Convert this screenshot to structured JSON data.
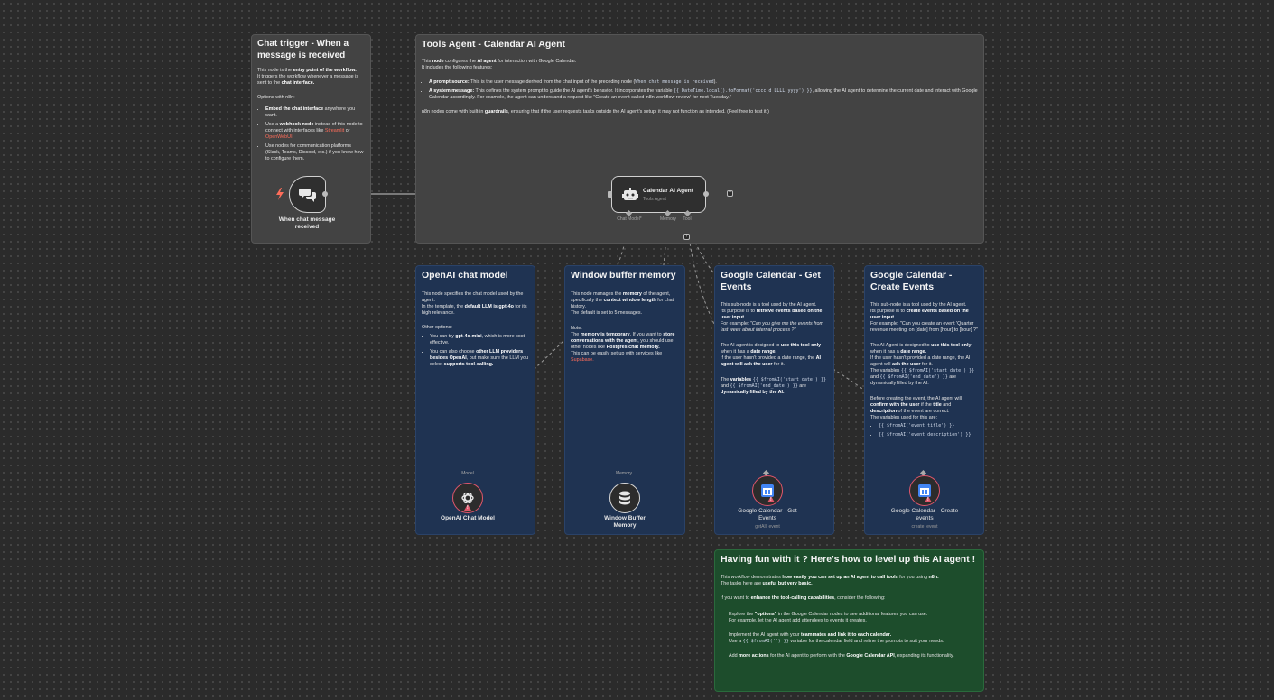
{
  "chat_trigger_note": {
    "title": "Chat trigger - When a message is received",
    "line1_pre": "This node is the ",
    "line1_bold": "entry point of the workflow.",
    "line2_pre": "It triggers the workflow whenever a message is sent to the ",
    "line2_bold": "chat interface.",
    "options_heading": "Options with n8n:",
    "opt1_bold": "Embed the chat interface",
    "opt1_rest": " anywhere you want.",
    "opt2_pre": "Use a ",
    "opt2_bold": "webhook node",
    "opt2_rest": " instead of this node to connect with interfaces like ",
    "opt2_link1": "Streamlit",
    "opt2_or": " or ",
    "opt2_link2": "OpenWebUI.",
    "opt3": "Use nodes for communication platforms (Slack, Teams, Discord, etc.) if you know how to configure them."
  },
  "tools_agent_note": {
    "title": "Tools Agent - Calendar AI Agent",
    "intro_pre": "This ",
    "intro_bold1": "node",
    "intro_mid": " configures the ",
    "intro_bold2": "AI agent",
    "intro_rest": " for interaction with Google Calendar.",
    "intro2": "It includes the following features:",
    "f1_bold": "A prompt source:",
    "f1_rest": " This is the user message derived from the chat input of the preceding node (",
    "f1_code": "When chat message is received",
    "f1_end": ").",
    "f2_bold": "A system message:",
    "f2_rest": " This defines the system prompt to guide the AI agent's behavior. It incorporates the variable ",
    "f2_code": "{{ DateTime.local().toFormat('cccc d LLLL yyyy') }}",
    "f2_end": ", allowing the AI agent to determine the current date and interact with Google Calendar accordingly. For example, the agent can understand a request like \"Create an event called 'n8n workflow review' for next Tuesday.\"",
    "guard_pre": "n8n nodes come with built-in ",
    "guard_bold": "guardrails",
    "guard_rest": ", ensuring that if the user requests tasks outside the AI agent's setup, it may not function as intended. (Feel free to test it!)"
  },
  "openai_note": {
    "title": "OpenAI chat model",
    "p1": "This node specifies the chat model used by the agent.",
    "p2_pre": "In the template, the ",
    "p2_bold": "default LLM is gpt-4o",
    "p2_rest": " for its high relevance.",
    "other": "Other options:",
    "o1_pre": "You can try ",
    "o1_bold": "gpt-4o-mini",
    "o1_rest": ", which is more cost-effective.",
    "o2_pre": "You can also choose ",
    "o2_bold": "other LLM providers besides OpenAI",
    "o2_rest": ", but make sure the LLM you select ",
    "o2_bold2": "supports tool-calling."
  },
  "memory_note": {
    "title": "Window buffer memory",
    "p1_pre": "This node manages the ",
    "p1_bold": "memory",
    "p1_mid": " of the agent, specifically the ",
    "p1_bold2": "context window length",
    "p1_rest": " for chat history.",
    "p2": "The default is set to 5 messages.",
    "note_label": "Note:",
    "n1_pre": "The ",
    "n1_bold": "memory is temporary",
    "n1_mid": ". If you want to ",
    "n1_bold2": "store conversations with the agent",
    "n1_rest": ", you should use other nodes like ",
    "n1_bold3": "Postgres chat memory.",
    "n2": "This can be easily set up with services like ",
    "n2_link": "Supabase."
  },
  "get_events_note": {
    "title": "Google Calendar - Get Events",
    "p1": "This sub-node is a tool used by the AI agent.",
    "p2_pre": "Its purpose is to ",
    "p2_bold": "retrieve events based on the user input.",
    "p3_pre": "For example: ",
    "p3_ital": "\"Can you give me the events from last week about internal process ?\"",
    "p4_pre": "The AI agent is designed to ",
    "p4_bold": "use this tool only",
    "p4_mid": " when it has a ",
    "p4_bold2": "date range.",
    "p5_pre": "If the user hasn't provided a date range, the ",
    "p5_bold": "AI agent will ask the user",
    "p5_rest": " for it.",
    "p6_pre": "The ",
    "p6_bold": "variables",
    "p6_code1": "{{ $fromAI('start_date') }}",
    "p6_and": " and ",
    "p6_code2": "{{ $fromAI('end_date') }}",
    "p6_rest": " are ",
    "p6_bold2": "dynamically filled by the AI."
  },
  "create_events_note": {
    "title": "Google Calendar - Create Events",
    "p1": "This sub-node is a tool used by the AI agent.",
    "p2_pre": "Its purpose is to ",
    "p2_bold": "create events based on the user input.",
    "p3": "For example: \"Can you create an event 'Quarter revenue meeting' on [date] from [hour] to [hour] ?\"",
    "p4_pre": "The AI Agent is designed to ",
    "p4_bold": "use this tool only",
    "p4_mid": " when it has a ",
    "p4_bold2": "date range.",
    "p5_pre": "If the user hasn't provided a date range, the AI agent will ",
    "p5_bold": "ask the user",
    "p5_rest": " for it.",
    "p6_pre": "The variables ",
    "p6_code1": "{{ $fromAI('start_date') }}",
    "p6_and": " and ",
    "p6_code2": "{{ $fromAI('end_date') }}",
    "p6_rest": " are dynamically filled by the AI.",
    "p7_pre": "Before creating the event, the AI agent will ",
    "p7_bold": "confirm with the user",
    "p7_mid": " if the ",
    "p7_bold2": "title",
    "p7_and": " and ",
    "p7_bold3": "description",
    "p7_rest": " of the event are correct.",
    "p8": "The variables used for this are:",
    "v1": "{{ $fromAI('event_title') }}",
    "v2": "{{ $fromAI('event_description') }}"
  },
  "level_up_note": {
    "title": "Having fun with it ? Here's how to level up this AI agent !",
    "p1_pre": "This workflow demonstrates ",
    "p1_bold": "how easily you can set up an AI agent to call tools",
    "p1_rest": " for you using ",
    "p1_bold2": "n8n.",
    "p2_pre": "The tasks here are ",
    "p2_bold": "useful but very basic.",
    "p3_pre": "If you want to ",
    "p3_bold": "enhance the tool-calling capabilities",
    "p3_rest": ", consider the following:",
    "b1_pre": "Explore the ",
    "b1_bold": "\"options\"",
    "b1_rest": " in the Google Calendar nodes to see additional features you can use.",
    "b1_line2": "For example, let the AI agent add attendees to events it creates.",
    "b2_pre": "Implement the AI agent with your ",
    "b2_bold": "teammates and link it to each calendar.",
    "b2_line2_pre": "Use a ",
    "b2_code": "{{ $fromAI('') }}",
    "b2_line2_rest": " variable for the calendar field and refine the prompts to suit your needs.",
    "b3_pre": "Add ",
    "b3_bold": "more actions",
    "b3_mid": " for the AI agent to perform with the ",
    "b3_bold2": "Google Calendar API",
    "b3_rest": ", expanding its functionality."
  },
  "nodes": {
    "trigger": {
      "label": "When chat message received"
    },
    "agent": {
      "title": "Calendar AI Agent",
      "subtitle": "Tools Agent",
      "port_model": "Chat Model*",
      "port_memory": "Memory",
      "port_tool": "Tool"
    },
    "openai": {
      "port": "Model",
      "label": "OpenAI Chat Model"
    },
    "memory": {
      "port": "Memory",
      "label": "Window Buffer Memory"
    },
    "get_events": {
      "label": "Google Calendar - Get Events",
      "subtitle": "getAll: event"
    },
    "create_events": {
      "label": "Google Calendar - Create events",
      "subtitle": "create: event"
    }
  },
  "colors": {
    "canvas": "#2b2b2b",
    "note_gray": "#434343",
    "note_blue": "#1f3352",
    "note_green": "#1d4d2c",
    "accent_red": "#ff6d5a",
    "error": "#e0566b"
  },
  "icons": [
    "bolt-icon",
    "chat-icon",
    "robot-icon",
    "openai-icon",
    "database-icon",
    "calendar-icon",
    "warning-icon",
    "plus-icon"
  ]
}
